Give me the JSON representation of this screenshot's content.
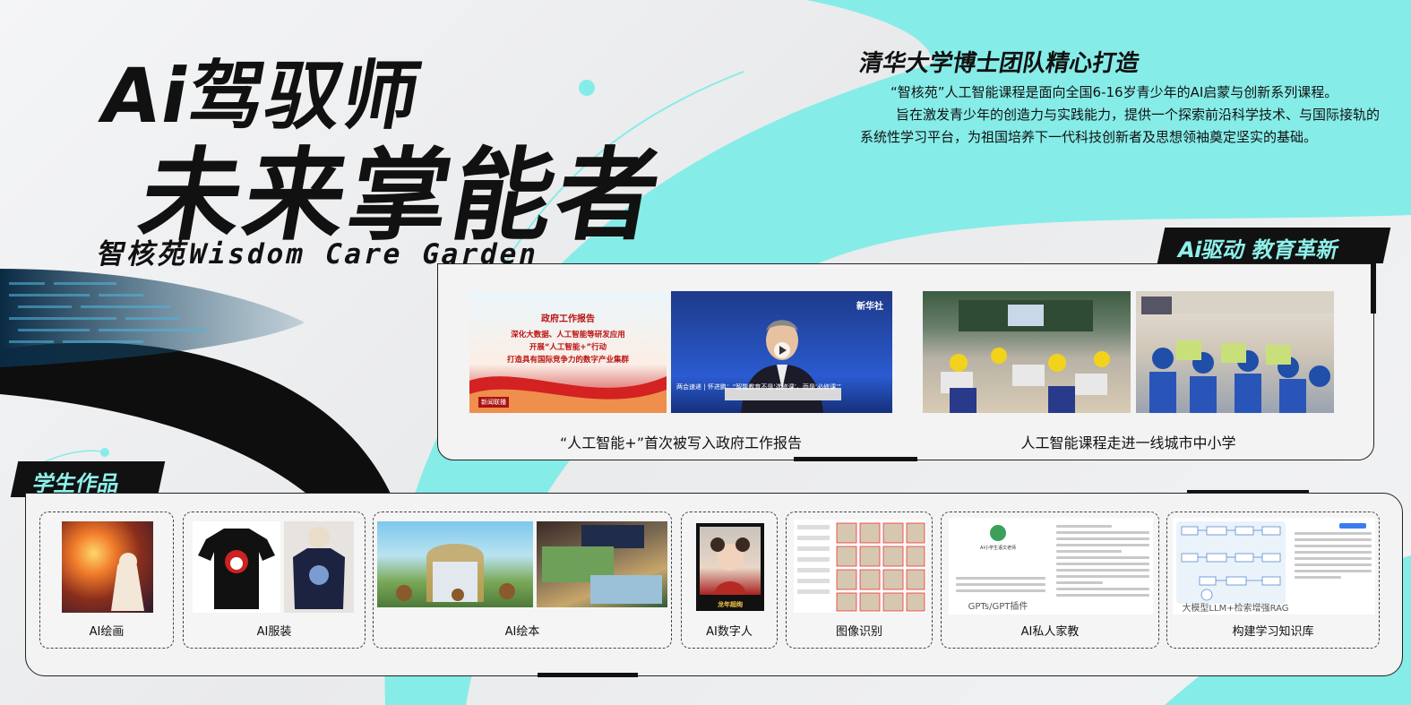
{
  "hero": {
    "title_line1": "Ai驾驭师",
    "title_line2": "未来掌能者",
    "brand": "智核苑Wisdom Care Garden"
  },
  "intro": {
    "heading": "清华大学博士团队精心打造",
    "paragraph1": "“智核苑”人工智能课程是面向全国6-16岁青少年的AI启蒙与创新系列课程。",
    "paragraph2": "旨在激发青少年的创造力与实践能力，提供一个探索前沿科学技术、与国际接轨的系统性学习平台，为祖国培养下一代科技创新者及思想领袖奠定坚实的基础。"
  },
  "news_section": {
    "tag": "Ai驱动 教育革新",
    "slide1": {
      "heading": "政府工作报告",
      "line1": "深化大数据、人工智能等研发应用",
      "line2": "开展“人工智能+”行动",
      "line3": "打造具有国际竞争力的数字产业集群",
      "corner_badge": "新闻联播"
    },
    "slide2": {
      "logo": "新华社",
      "subtitle": "两会速递 | 怀进鹏：“智能教育不是‘选修课’，而是‘必修课’”"
    },
    "caption_left": "“人工智能+”首次被写入政府工作报告",
    "caption_right": "人工智能课程走进一线城市中小学"
  },
  "works_section": {
    "tag": "学生作品",
    "cards": [
      {
        "label": "AI绘画"
      },
      {
        "label": "AI服装"
      },
      {
        "label": "AI绘本"
      },
      {
        "label": "AI数字人"
      },
      {
        "label": "图像识别"
      },
      {
        "label": "AI私人家教"
      },
      {
        "label": "构建学习知识库"
      }
    ],
    "gpt_card": {
      "title": "AI小学生语文老师",
      "overlay": "GPTs/GPT插件"
    },
    "rag_card": {
      "overlay": "大模型LLM+检索增强RAG"
    },
    "digital_human_caption": "龙年超绚"
  },
  "colors": {
    "accent": "#8ef0ea",
    "dark": "#111111",
    "panel": "#f3f3f3"
  }
}
